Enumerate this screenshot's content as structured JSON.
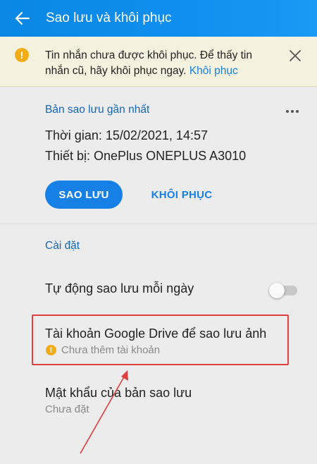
{
  "appbar": {
    "title": "Sao lưu và khôi phục",
    "back_icon": "arrow-left-icon"
  },
  "banner": {
    "message": "Tin nhắn chưa được khôi phục. Để thấy tin nhắn cũ, hãy khôi phục ngay.",
    "link": "Khôi phục",
    "icon_glyph": "!",
    "close_icon": "close-icon"
  },
  "backup": {
    "title": "Bản sao lưu gần nhất",
    "time": "Thời gian: 15/02/2021, 14:57",
    "device": "Thiết bị: OnePlus ONEPLUS A3010",
    "backup_button": "SAO LƯU",
    "restore_button": "KHÔI PHỤC"
  },
  "settings": {
    "title": "Cài đặt",
    "auto_backup": {
      "label": "Tự động sao lưu mỗi ngày",
      "enabled": false
    },
    "drive_account": {
      "label": "Tài khoản Google Drive để sao lưu ảnh",
      "status": "Chưa thêm tài khoản",
      "status_glyph": "!"
    },
    "password": {
      "label": "Mật khẩu của bản sao lưu",
      "status": "Chưa đặt"
    }
  },
  "colors": {
    "accent": "#1680e6",
    "warning": "#f2ad16",
    "annotation": "#e04040"
  }
}
